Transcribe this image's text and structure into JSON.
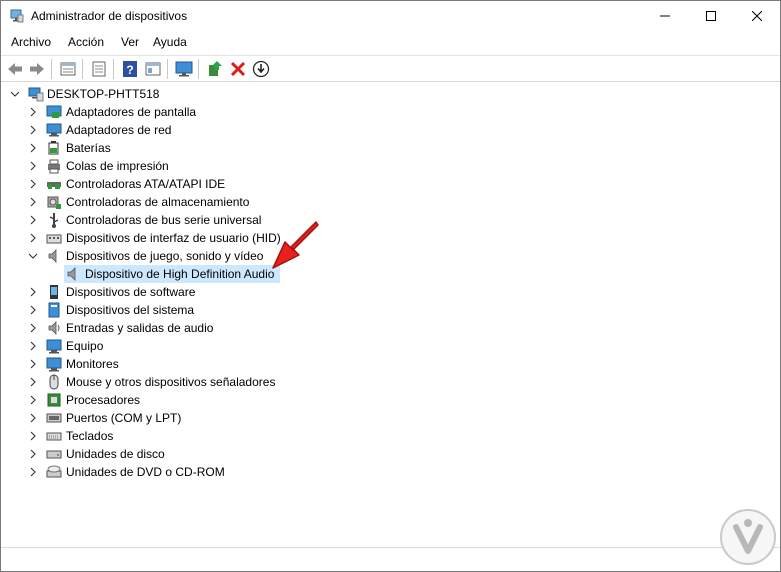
{
  "window": {
    "title": "Administrador de dispositivos"
  },
  "menu": {
    "items": [
      "Archivo",
      "Acción",
      "Ver",
      "Ayuda"
    ]
  },
  "toolbar": {
    "buttons": [
      "back-icon",
      "forward-icon",
      "properties-icon",
      "details-icon",
      "help-icon",
      "view-icon",
      "monitor-scan-icon",
      "update-driver-icon",
      "uninstall-icon",
      "download-icon"
    ]
  },
  "tree": {
    "root": "DESKTOP-PHTT518",
    "categories": [
      "Adaptadores de pantalla",
      "Adaptadores de red",
      "Baterías",
      "Colas de impresión",
      "Controladoras ATA/ATAPI IDE",
      "Controladoras de almacenamiento",
      "Controladoras de bus serie universal",
      "Dispositivos de interfaz de usuario (HID)",
      "Dispositivos de juego, sonido y vídeo",
      "Dispositivos de software",
      "Dispositivos del sistema",
      "Entradas y salidas de audio",
      "Equipo",
      "Monitores",
      "Mouse y otros dispositivos señaladores",
      "Procesadores",
      "Puertos (COM y LPT)",
      "Teclados",
      "Unidades de disco",
      "Unidades de DVD o CD-ROM"
    ],
    "expanded_child": "Dispositivo de High Definition Audio"
  },
  "colors": {
    "selection": "#cce8ff",
    "arrow": "#e8211f",
    "accent": "#0078d7"
  }
}
